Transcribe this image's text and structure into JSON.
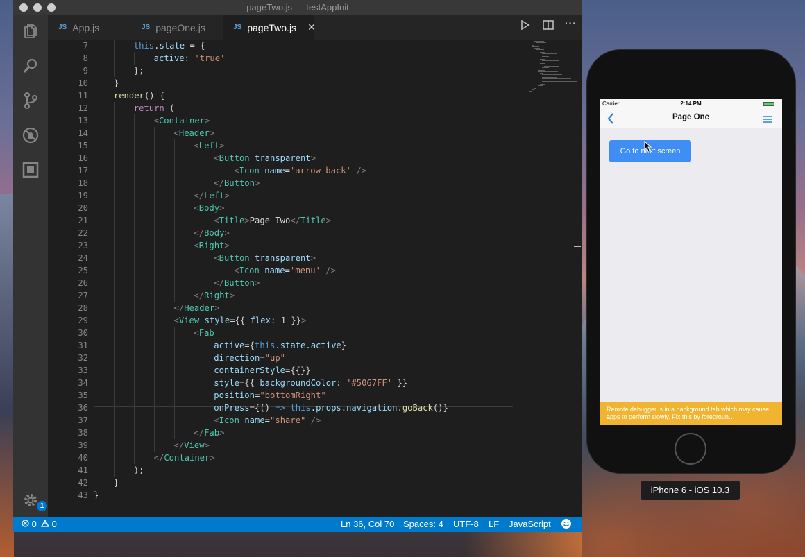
{
  "window": {
    "title": "pageTwo.js — testAppInit"
  },
  "tabs": [
    {
      "label": "App.js",
      "icon": "JS"
    },
    {
      "label": "pageOne.js",
      "icon": "JS"
    },
    {
      "label": "pageTwo.js",
      "icon": "JS",
      "close": "✕"
    }
  ],
  "editor": {
    "lines": [
      {
        "n": "7",
        "indent": 2
      },
      {
        "n": "8",
        "indent": 3
      },
      {
        "n": "9",
        "indent": 2
      },
      {
        "n": "10",
        "indent": 1
      },
      {
        "n": "11",
        "indent": 1
      },
      {
        "n": "12",
        "indent": 2
      },
      {
        "n": "13",
        "indent": 3
      },
      {
        "n": "14",
        "indent": 4
      },
      {
        "n": "15",
        "indent": 5
      },
      {
        "n": "16",
        "indent": 6
      },
      {
        "n": "17",
        "indent": 7
      },
      {
        "n": "18",
        "indent": 6
      },
      {
        "n": "19",
        "indent": 5
      },
      {
        "n": "20",
        "indent": 5
      },
      {
        "n": "21",
        "indent": 6
      },
      {
        "n": "22",
        "indent": 5
      },
      {
        "n": "23",
        "indent": 5
      },
      {
        "n": "24",
        "indent": 6
      },
      {
        "n": "25",
        "indent": 7
      },
      {
        "n": "26",
        "indent": 6
      },
      {
        "n": "27",
        "indent": 5
      },
      {
        "n": "28",
        "indent": 4
      },
      {
        "n": "29",
        "indent": 4
      },
      {
        "n": "30",
        "indent": 5
      },
      {
        "n": "31",
        "indent": 6
      },
      {
        "n": "32",
        "indent": 6
      },
      {
        "n": "33",
        "indent": 6
      },
      {
        "n": "34",
        "indent": 6
      },
      {
        "n": "35",
        "indent": 6
      },
      {
        "n": "36",
        "indent": 6
      },
      {
        "n": "37",
        "indent": 6
      },
      {
        "n": "38",
        "indent": 5
      },
      {
        "n": "39",
        "indent": 4
      },
      {
        "n": "40",
        "indent": 3
      },
      {
        "n": "41",
        "indent": 2
      },
      {
        "n": "42",
        "indent": 1
      },
      {
        "n": "43",
        "indent": 0
      }
    ]
  },
  "status": {
    "errors": "0",
    "warnings": "0",
    "position": "Ln 36, Col 70",
    "spaces": "Spaces: 4",
    "encoding": "UTF-8",
    "eol": "LF",
    "language": "JavaScript"
  },
  "activity": {
    "badge": "1"
  },
  "simulator": {
    "carrier": "Carrier",
    "time": "2:14 PM",
    "nav_title": "Page One",
    "button_label": "Go to next screen",
    "warning": "Remote debugger is in a background tab which may cause apps to perform slowly. Fix this by foregroun…",
    "device_label": "iPhone 6 - iOS 10.3"
  },
  "colors": {
    "accent": "#007acc",
    "ios_button": "#3f8ef6",
    "warning": "#f1b431"
  }
}
